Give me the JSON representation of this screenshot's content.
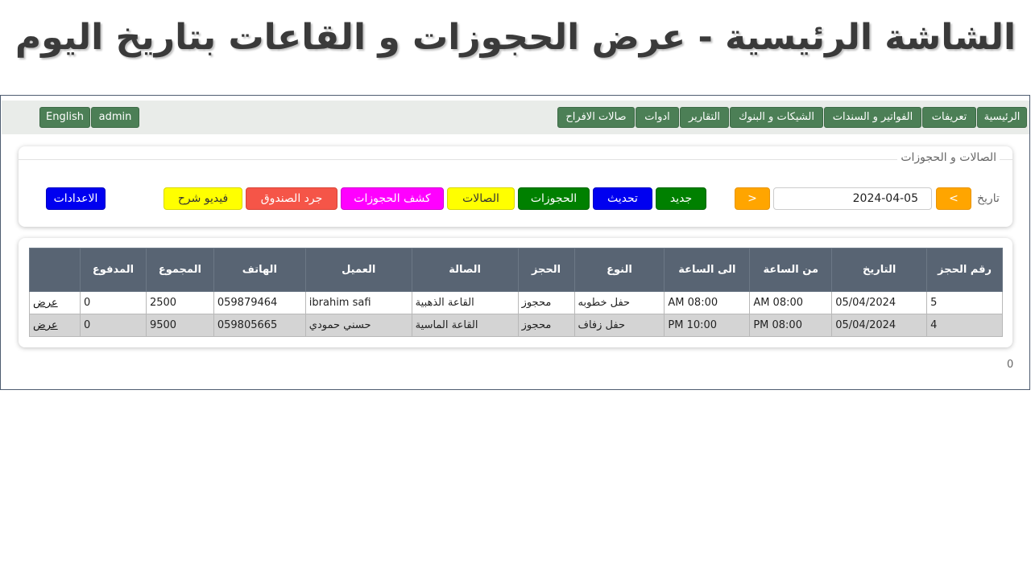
{
  "slide_title": "الشاشة الرئيسية - عرض الحجوزات و القاعات بتاريخ اليوم",
  "navbar": {
    "menu": [
      "الرئيسية",
      "تعريفات",
      "الفواتير و السندات",
      "الشيكات و البنوك",
      "التقارير",
      "ادوات",
      "صالات الافراح"
    ],
    "user": "admin",
    "language": "English",
    "color": "#4c7f56"
  },
  "controls": {
    "section_title": "الصالات و الحجوزات",
    "date_label": "تاريخ",
    "date_value": "2024-04-05",
    "prev_label": "<",
    "next_label": ">",
    "buttons": {
      "new": "جديد",
      "refresh": "تحديث",
      "bookings": "الحجوزات",
      "halls": "الصالات",
      "bookings_report": "كشف الحجوزات",
      "cash_count": "جرد الصندوق",
      "video": "فيديو شرح",
      "settings": "الاعدادات"
    }
  },
  "table": {
    "headers": [
      "رقم الحجز",
      "التاريخ",
      "من الساعة",
      "الى الساعة",
      "النوع",
      "الحجز",
      "الصالة",
      "العميل",
      "الهاتف",
      "المجموع",
      "المدفوع",
      ""
    ],
    "rows": [
      [
        "5",
        "05/04/2024",
        "AM 08:00",
        "AM 08:00",
        "حفل خطوبه",
        "محجوز",
        "القاعة الذهبية",
        "ibrahim safi",
        "059879464",
        "2500",
        "0",
        "عرض"
      ],
      [
        "4",
        "05/04/2024",
        "PM 08:00",
        "PM 10:00",
        "حفل زفاف",
        "محجوز",
        "القاعة الماسية",
        "حسني حمودي",
        "059805665",
        "9500",
        "0",
        "عرض"
      ]
    ],
    "header_color": "#586473"
  },
  "footer_count": "0"
}
